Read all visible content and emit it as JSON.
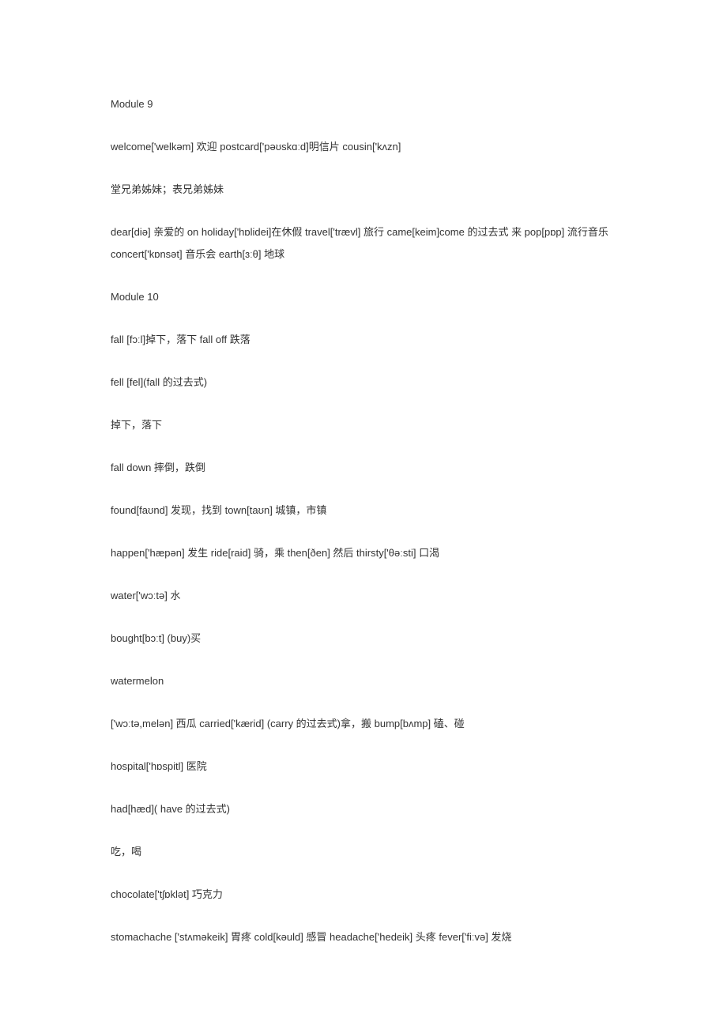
{
  "paragraphs": [
    "Module 9",
    "welcome['welkəm] 欢迎 postcard['pəʊskɑːd]明信片 cousin['kʌzn]",
    "堂兄弟姊妹；表兄弟姊妹",
    "dear[diə] 亲爱的 on holiday['hɒlidei]在休假 travel['trævl] 旅行 came[keim]come 的过去式 来 pop[pɒp] 流行音乐 concert['kɒnsət] 音乐会 earth[ɜːθ] 地球",
    "Module 10",
    "fall [fɔːl]掉下，落下 fall off 跌落",
    "fell [fel](fall 的过去式)",
    "掉下，落下",
    "fall down 摔倒，跌倒",
    "found[faʊnd] 发现，找到 town[taʊn] 城镇，市镇",
    "happen['hæpən] 发生 ride[raid] 骑，乘 then[ðen] 然后 thirsty['θəːsti] 口渴",
    "water['wɔːtə] 水",
    "bought[bɔːt] (buy)买",
    "watermelon",
    "['wɔːtə,melən] 西瓜 carried['kærid] (carry 的过去式)拿，搬 bump[bʌmp] 磕、碰",
    "hospital['hɒspitl] 医院",
    "had[hæd]( have 的过去式)",
    "吃，喝",
    "chocolate['tʃɒklət] 巧克力",
    "stomachache ['stʌməkeik] 胃疼 cold[kəuld] 感冒 headache['hedeik] 头疼 fever['fiːvə] 发烧"
  ]
}
